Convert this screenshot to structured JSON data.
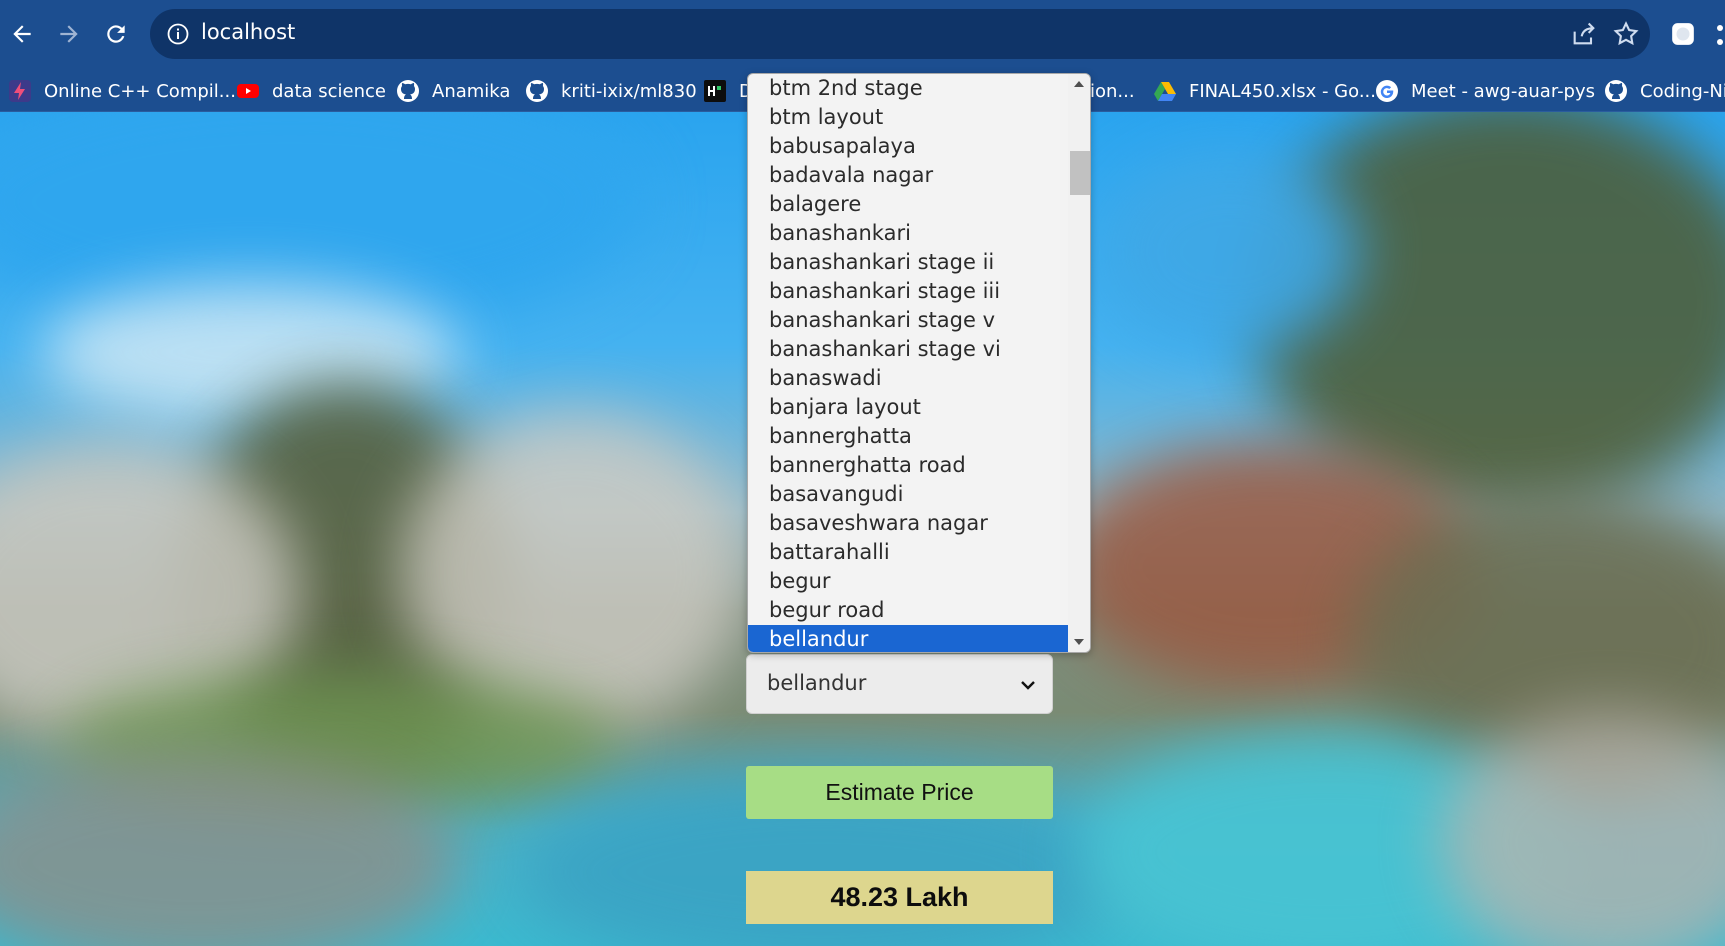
{
  "browser": {
    "url": "localhost"
  },
  "bookmarks": [
    {
      "label": "Online C++ Compil...",
      "icon": "lightning-icon"
    },
    {
      "label": "data science",
      "icon": "youtube-icon"
    },
    {
      "label": "Anamika",
      "icon": "github-icon"
    },
    {
      "label": "kriti-ixix/ml830",
      "icon": "github-icon"
    },
    {
      "label": "D",
      "icon": "hackerrank-icon"
    },
    {
      "label": "ion...",
      "icon": ""
    },
    {
      "label": "FINAL450.xlsx - Go...",
      "icon": "google-drive-icon"
    },
    {
      "label": "Meet - awg-auar-pys",
      "icon": "google-icon"
    },
    {
      "label": "Coding-Ni",
      "icon": "github-icon"
    }
  ],
  "location": {
    "selected": "bellandur",
    "options": [
      "btm 2nd stage",
      "btm layout",
      "babusapalaya",
      "badavala nagar",
      "balagere",
      "banashankari",
      "banashankari stage ii",
      "banashankari stage iii",
      "banashankari stage v",
      "banashankari stage vi",
      "banaswadi",
      "banjara layout",
      "bannerghatta",
      "bannerghatta road",
      "basavangudi",
      "basaveshwara nagar",
      "battarahalli",
      "begur",
      "begur road",
      "bellandur"
    ]
  },
  "form": {
    "estimate_label": "Estimate Price",
    "result": "48.23 Lakh"
  },
  "colors": {
    "chrome": "#1c4e90",
    "selected_option": "#1a66d2",
    "estimate_button": "#a7dd85",
    "result_box": "#ddd68e"
  }
}
